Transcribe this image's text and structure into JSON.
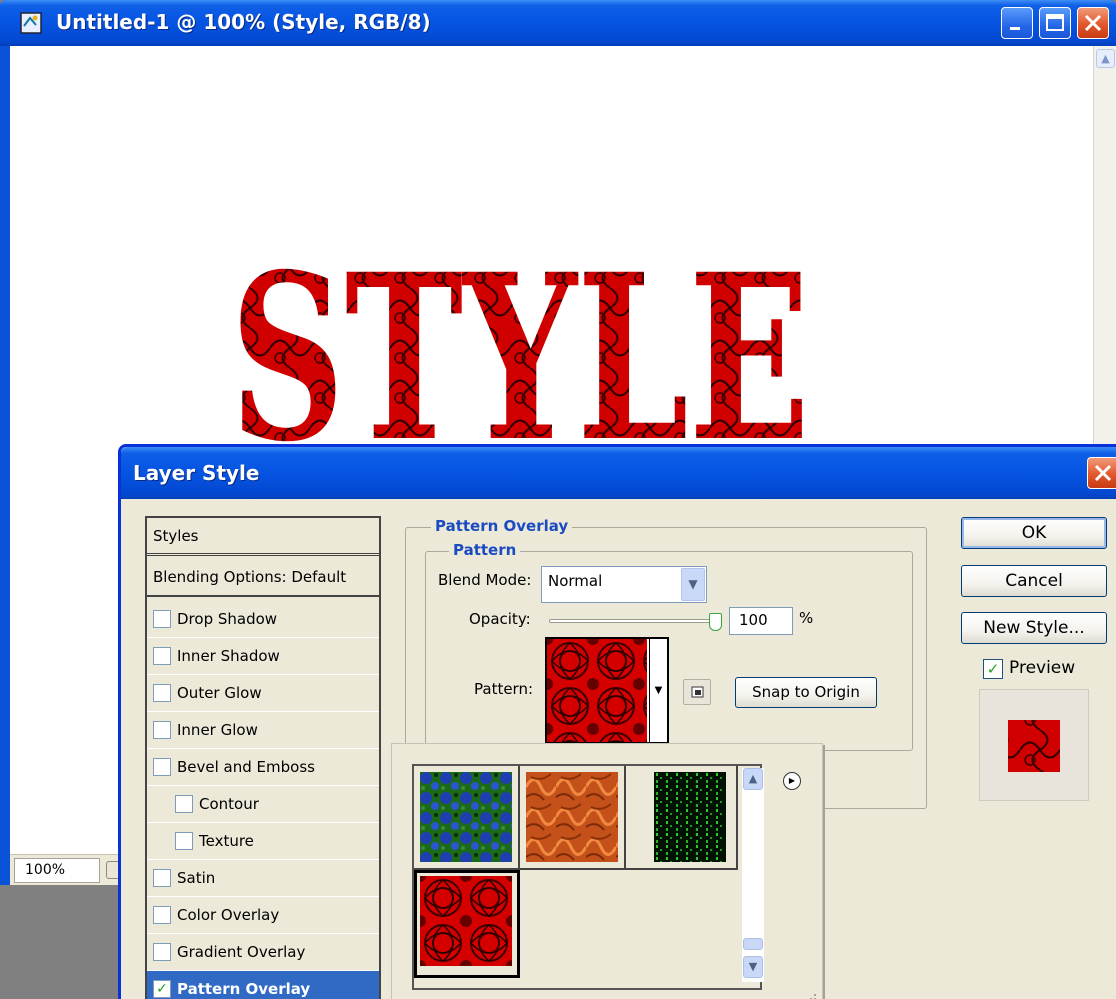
{
  "document_window": {
    "title": "Untitled-1 @ 100% (Style, RGB/8)",
    "canvas_text": "STYLE",
    "zoom": "100%",
    "buttons": [
      "minimize",
      "maximize",
      "close"
    ]
  },
  "dialog": {
    "title": "Layer Style",
    "styles_list": {
      "header": "Styles",
      "blending": "Blending Options: Default",
      "items": [
        {
          "label": "Drop Shadow",
          "checked": false,
          "indent": false
        },
        {
          "label": "Inner Shadow",
          "checked": false,
          "indent": false
        },
        {
          "label": "Outer Glow",
          "checked": false,
          "indent": false
        },
        {
          "label": "Inner Glow",
          "checked": false,
          "indent": false
        },
        {
          "label": "Bevel and Emboss",
          "checked": false,
          "indent": false
        },
        {
          "label": "Contour",
          "checked": false,
          "indent": true
        },
        {
          "label": "Texture",
          "checked": false,
          "indent": true
        },
        {
          "label": "Satin",
          "checked": false,
          "indent": false
        },
        {
          "label": "Color Overlay",
          "checked": false,
          "indent": false
        },
        {
          "label": "Gradient Overlay",
          "checked": false,
          "indent": false
        },
        {
          "label": "Pattern Overlay",
          "checked": true,
          "indent": false,
          "selected": true
        }
      ]
    },
    "panel": {
      "group_title": "Pattern Overlay",
      "subgroup_title": "Pattern",
      "blend_mode_label": "Blend Mode:",
      "blend_mode_value": "Normal",
      "opacity_label": "Opacity:",
      "opacity_value": "100",
      "opacity_unit": "%",
      "opacity_fraction": 1.0,
      "pattern_label": "Pattern:",
      "snap_button": "Snap to Origin"
    },
    "buttons": {
      "ok": "OK",
      "cancel": "Cancel",
      "new_style": "New Style..."
    },
    "preview": {
      "label": "Preview",
      "checked": true
    },
    "pattern_picker": {
      "swatches": [
        {
          "name": "blue-green",
          "color": "#1f3fa8"
        },
        {
          "name": "orange-swirl",
          "color": "#c8501a"
        },
        {
          "name": "green-matrix",
          "color": "#0a4a0a"
        },
        {
          "name": "red-pattern",
          "color": "#cc0000",
          "selected": true
        }
      ]
    }
  }
}
